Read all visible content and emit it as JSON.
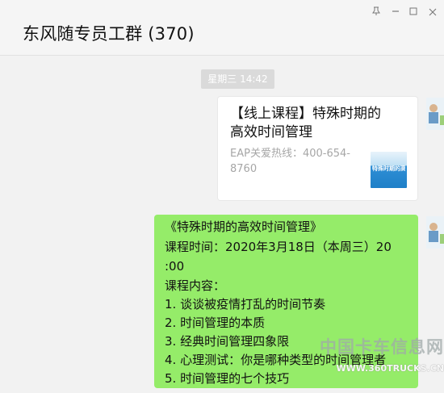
{
  "header": {
    "title": "东风随专员工群 (370)",
    "pin_icon": "pin-icon",
    "minimize_icon": "minimize-icon",
    "maximize_icon": "maximize-icon",
    "close_icon": "close-icon"
  },
  "timestamp": "星期三 14:42",
  "card": {
    "title": "【线上课程】特殊时期的高效时间管理",
    "description": "EAP关爱热线：400-654-8760",
    "thumbnail_text": "特殊时期的高效时间管理"
  },
  "message": {
    "lines": [
      "《特殊时期的高效时间管理》",
      "课程时间：2020年3月18日（本周三）20",
      ":00",
      "课程内容：",
      "1. 谈谈被疫情打乱的时间节奏",
      "2. 时间管理的本质",
      "3. 经典时间管理四象限",
      "4. 心理测试：你是哪种类型的时间管理者",
      "5. 时间管理的七个技巧"
    ]
  },
  "watermark": {
    "chinese": "中国卡车信息网",
    "domain": "WWW.360TRUCKS.CN"
  },
  "colors": {
    "bubble": "#95ec69",
    "timestamp_bg": "#dadada",
    "card_bg": "#ffffff",
    "background": "#f2f2f2"
  }
}
